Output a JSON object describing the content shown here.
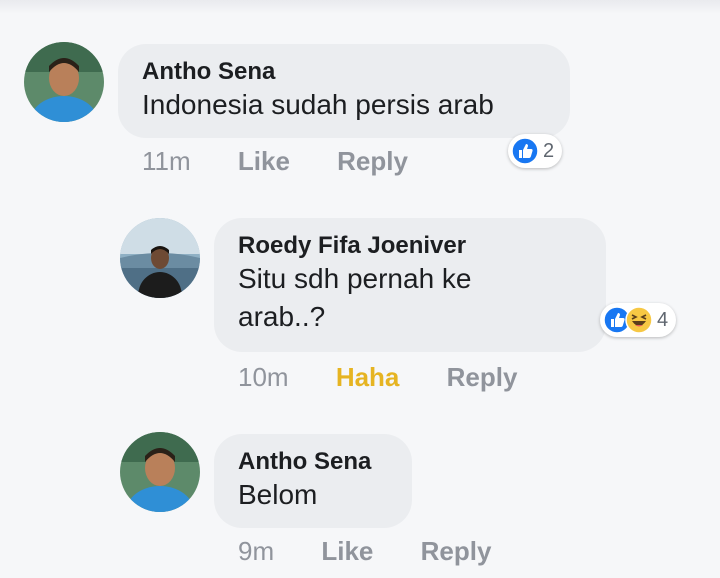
{
  "colors": {
    "background": "#f6f7f9",
    "bubble": "#ebedf0",
    "like_blue": "#1877f2",
    "haha_yellow": "#e6b422",
    "meta_gray": "#90949c"
  },
  "comments": [
    {
      "author": "Antho Sena",
      "text": "Indonesia sudah persis arab",
      "time": "11m",
      "action_1": "Like",
      "action_2": "Reply",
      "reaction_icons": [
        "like-icon"
      ],
      "reaction_count": "2"
    },
    {
      "author": "Roedy Fifa Joeniver",
      "text": "Situ sdh pernah ke arab..?",
      "time": "10m",
      "action_1": "Haha",
      "action_2": "Reply",
      "reaction_icons": [
        "like-icon",
        "haha-icon"
      ],
      "reaction_count": "4"
    },
    {
      "author": "Antho Sena",
      "text": "Belom",
      "time": "9m",
      "action_1": "Like",
      "action_2": "Reply",
      "reaction_icons": [],
      "reaction_count": ""
    }
  ]
}
